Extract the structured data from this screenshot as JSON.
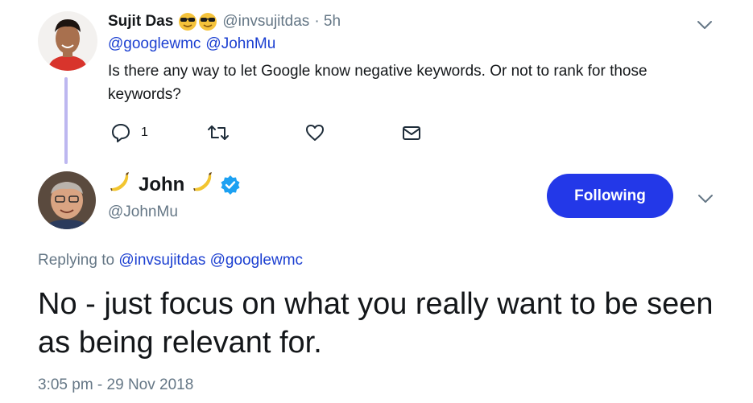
{
  "parent_tweet": {
    "author_name": "Sujit Das",
    "author_emoji": "😎😎",
    "author_handle": "@invsujitdas",
    "time_ago": "· 5h",
    "mentions": [
      "@googlewmc",
      "@JohnMu"
    ],
    "text": "Is there any way to let Google know negative keywords. Or not to rank for those keywords?",
    "reply_count": "1",
    "icons": [
      "reply-icon",
      "retweet-icon",
      "like-icon",
      "direct-message-icon",
      "chevron-down-icon"
    ]
  },
  "main_tweet": {
    "author_name": "John",
    "author_emoji_left": "🍌",
    "author_emoji_right": "🍌",
    "author_handle": "@JohnMu",
    "verified": true,
    "follow_button_label": "Following",
    "replying_prefix": "Replying to",
    "replying_to": [
      "@invsujitdas",
      "@googlewmc"
    ],
    "text": "No - just focus on what you really want to be seen as being relevant for.",
    "timestamp": "3:05 pm - 29 Nov 2018",
    "icons": [
      "verified-badge-icon",
      "chevron-down-icon"
    ]
  },
  "colors": {
    "link": "#1b3fd1",
    "muted": "#657786",
    "follow_button": "#2338e8",
    "thread_line": "#bdb7f0",
    "verified": "#1da1f2"
  }
}
